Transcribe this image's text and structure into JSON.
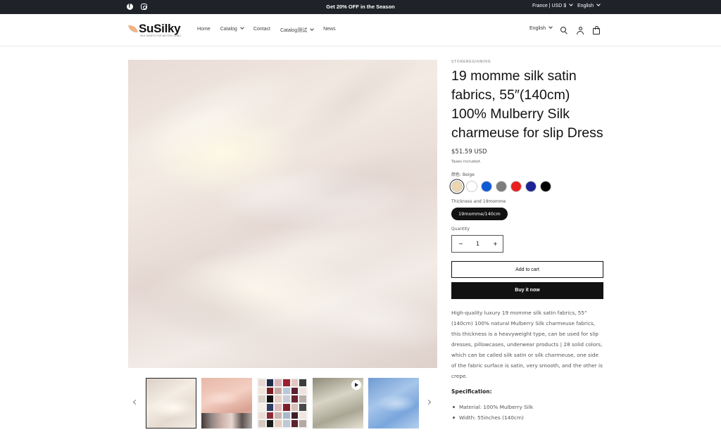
{
  "announcement": {
    "message": "Get 20% OFF in the Season",
    "country_currency": "France | USD $",
    "language": "English",
    "social_icons": [
      "facebook-icon",
      "instagram-icon"
    ]
  },
  "header": {
    "logo_text": "SuSilky",
    "logo_tagline": "SILK SHEETS FOR BETTER LIVING",
    "nav": [
      {
        "label": "Home",
        "has_dropdown": false
      },
      {
        "label": "Catalog",
        "has_dropdown": true
      },
      {
        "label": "Contact",
        "has_dropdown": false
      },
      {
        "label": "Catalog测试",
        "has_dropdown": true
      },
      {
        "label": "News",
        "has_dropdown": false
      }
    ],
    "language": "English",
    "icons": [
      "search-icon",
      "account-icon",
      "cart-icon"
    ]
  },
  "product": {
    "vendor": "STOREBEGINNING",
    "title": "19 momme silk satin fabrics, 55″(140cm) 100% Mulberry Silk charmeuse for slip Dress",
    "price": "$51.59 USD",
    "tax_note": "Taxes included.",
    "color_label": "颜色: Beige",
    "colors": [
      {
        "name": "Beige",
        "hex": "#ecd6ad",
        "selected": true
      },
      {
        "name": "White",
        "hex": "#ffffff",
        "selected": false
      },
      {
        "name": "Blue",
        "hex": "#0f5bd6",
        "selected": false
      },
      {
        "name": "Gray",
        "hex": "#7d7d7d",
        "selected": false
      },
      {
        "name": "Red",
        "hex": "#e8201f",
        "selected": false
      },
      {
        "name": "Navy",
        "hex": "#1c2493",
        "selected": false
      },
      {
        "name": "Black",
        "hex": "#000000",
        "selected": false
      }
    ],
    "thickness_label": "Thickness and 19momme",
    "thickness_option": "19momme/140cm",
    "quantity_label": "Quantity",
    "quantity_value": "1",
    "quantity_minus": "−",
    "quantity_plus": "+",
    "add_to_cart": "Add to cart",
    "buy_now": "Buy it now",
    "description": "High-quality luxury 19 momme silk satin fabrics, 55\"(140cm) 100% natural Mulberry Silk charmeuse fabrics, this thickness is a heavyweight type, can be used for slip dresses, pillowcases, underwear products | 28 solid colors, which can be called silk satin or silk charmeuse, one side of the fabric surface is satin, very smooth, and the other is crepe.",
    "spec_heading": "Specification:",
    "specs": [
      "Material: 100% Mulberry Silk",
      "Width: 55inches (140cm)"
    ]
  },
  "gallery": {
    "thumbnails": [
      {
        "kind": "silk-cream",
        "selected": true
      },
      {
        "kind": "silk-pink",
        "selected": false
      },
      {
        "kind": "color-chart",
        "selected": false
      },
      {
        "kind": "video",
        "selected": false
      },
      {
        "kind": "silk-blue",
        "selected": false
      }
    ]
  }
}
